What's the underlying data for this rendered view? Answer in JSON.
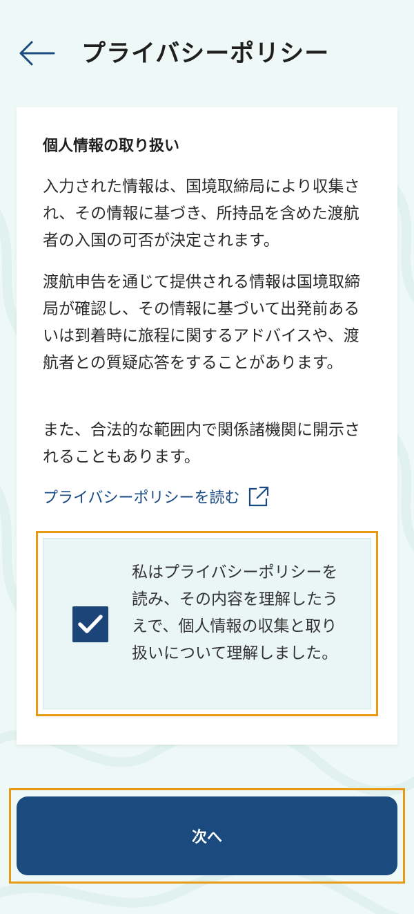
{
  "header": {
    "back_icon": "arrow-left-icon",
    "title": "プライバシーポリシー"
  },
  "card": {
    "heading": "個人情報の取り扱い",
    "paragraphs": [
      "入力された情報は、国境取締局により収集され、その情報に基づき、所持品を含めた渡航者の入国の可否が決定されます。",
      "渡航申告を通じて提供される情報は国境取締局が確認し、その情報に基づいて出発前あるいは到着時に旅程に関するアドバイスや、渡航者との質疑応答をすることがあります。",
      "また、合法的な範囲内で関係諸機関に開示されることもあります。"
    ],
    "link_label": "プライバシーポリシーを読む",
    "link_icon": "external-link-icon"
  },
  "consent": {
    "checked": true,
    "text": "私はプライバシーポリシーを読み、その内容を理解したうえで、個人情報の収集と取り扱いについて理解しました。"
  },
  "footer": {
    "next_label": "次へ"
  },
  "colors": {
    "primary": "#1b4a7e",
    "link": "#1a4a84",
    "highlight_outline": "#e89a15",
    "background": "#eef8f6",
    "consent_bg": "#eaf6f6"
  }
}
